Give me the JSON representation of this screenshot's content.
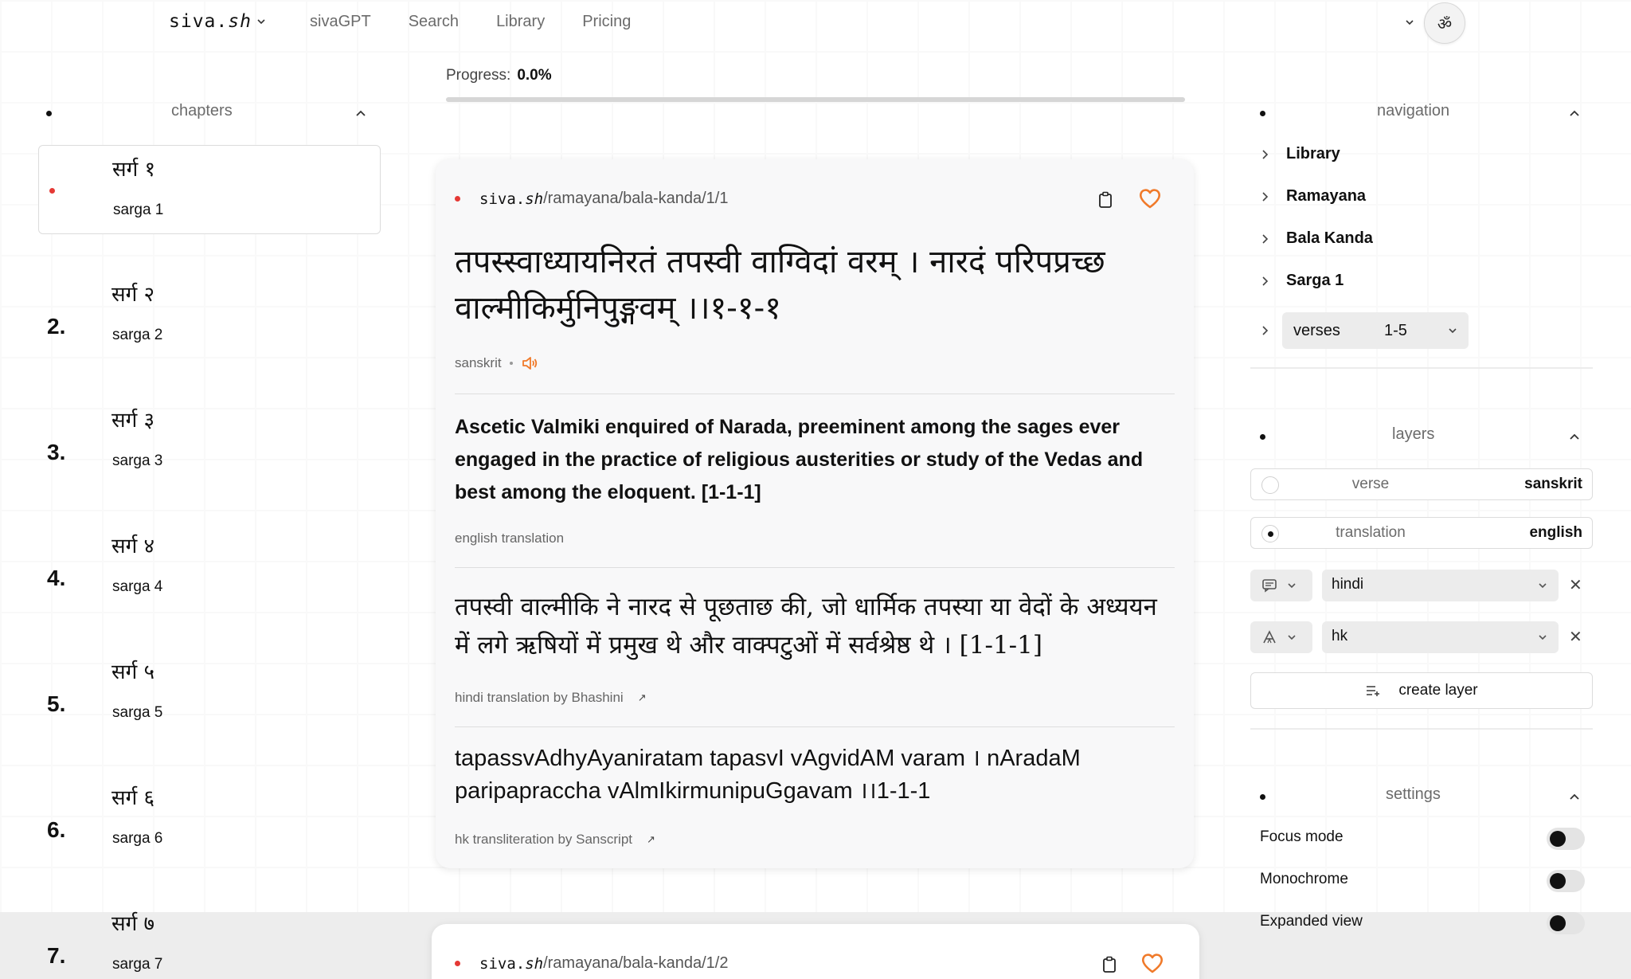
{
  "header": {
    "logo_prefix": "siva.",
    "logo_suffix": "sh",
    "nav": [
      "sivaGPT",
      "Search",
      "Library",
      "Pricing"
    ],
    "om_symbol": "ॐ"
  },
  "progress": {
    "label": "Progress:",
    "value_text": "0.0%",
    "fraction": 0.0
  },
  "chapters": {
    "title": "chapters",
    "items": [
      {
        "num": "",
        "devanagari": "सर्ग १",
        "latin": "sarga 1",
        "active": true
      },
      {
        "num": "2.",
        "devanagari": "सर्ग २",
        "latin": "sarga 2"
      },
      {
        "num": "3.",
        "devanagari": "सर्ग ३",
        "latin": "sarga 3"
      },
      {
        "num": "4.",
        "devanagari": "सर्ग ४",
        "latin": "sarga 4"
      },
      {
        "num": "5.",
        "devanagari": "सर्ग ५",
        "latin": "sarga 5"
      },
      {
        "num": "6.",
        "devanagari": "सर्ग ६",
        "latin": "sarga 6"
      },
      {
        "num": "7.",
        "devanagari": "सर्ग ७",
        "latin": "sarga 7"
      }
    ]
  },
  "verse": {
    "site_prefix": "siva.",
    "site_suffix": "sh",
    "path": "/ramayana/bala-kanda/1/1",
    "sanskrit": "तपस्स्वाध्यायनिरतं तपस्वी वाग्विदां वरम्  । नारदं परिपप्रच्छ वाल्मीकिर्मुनिपुङ्गवम्  ।।१-१-१",
    "sanskrit_label": "sanskrit",
    "english": "Ascetic Valmiki enquired of Narada, preeminent among the sages ever engaged in the practice of religious austerities or study of the Vedas and best among the eloquent. [1-1-1]",
    "english_label": "english translation",
    "hindi": "तपस्वी वाल्मीकि ने नारद से पूछताछ की, जो धार्मिक तपस्या या वेदों के अध्ययन में लगे ऋषियों में प्रमुख थे और वाक्पटुओं में सर्वश्रेष्ठ थे । [1-1-1]",
    "hindi_label": "hindi translation by Bhashini",
    "translit": "tapassvAdhyAyaniratam tapasvI vAgvidAM varam  । nAradaM paripapraccha vAlmIkirmunipuGgavam  ।।1-1-1",
    "translit_label": "hk transliteration by Sanscript"
  },
  "next_verse": {
    "path": "/ramayana/bala-kanda/1/2"
  },
  "navigation": {
    "title": "navigation",
    "items": [
      "Library",
      "Ramayana",
      "Bala Kanda",
      "Sarga 1"
    ],
    "verses_label": "verses",
    "verses_range": "1-5"
  },
  "layers": {
    "title": "layers",
    "rows": [
      {
        "name": "verse",
        "value": "sanskrit",
        "selected": false
      },
      {
        "name": "translation",
        "value": "english",
        "selected": true
      }
    ],
    "translation_select": "hindi",
    "script_select": "hk",
    "create_label": "create layer"
  },
  "settings": {
    "title": "settings",
    "items": [
      {
        "label": "Focus mode",
        "on": false
      },
      {
        "label": "Monochrome",
        "on": false
      },
      {
        "label": "Expanded view",
        "on": false
      }
    ]
  },
  "colors": {
    "accent_red": "#e53935",
    "heart_orange": "#f07a2a"
  },
  "icons": [
    "chevron-down-icon",
    "chevron-up-icon",
    "chevron-right-icon",
    "clipboard-icon",
    "heart-icon",
    "speaker-icon",
    "comment-icon",
    "script-icon",
    "close-icon",
    "list-add-icon",
    "external-link-icon"
  ]
}
